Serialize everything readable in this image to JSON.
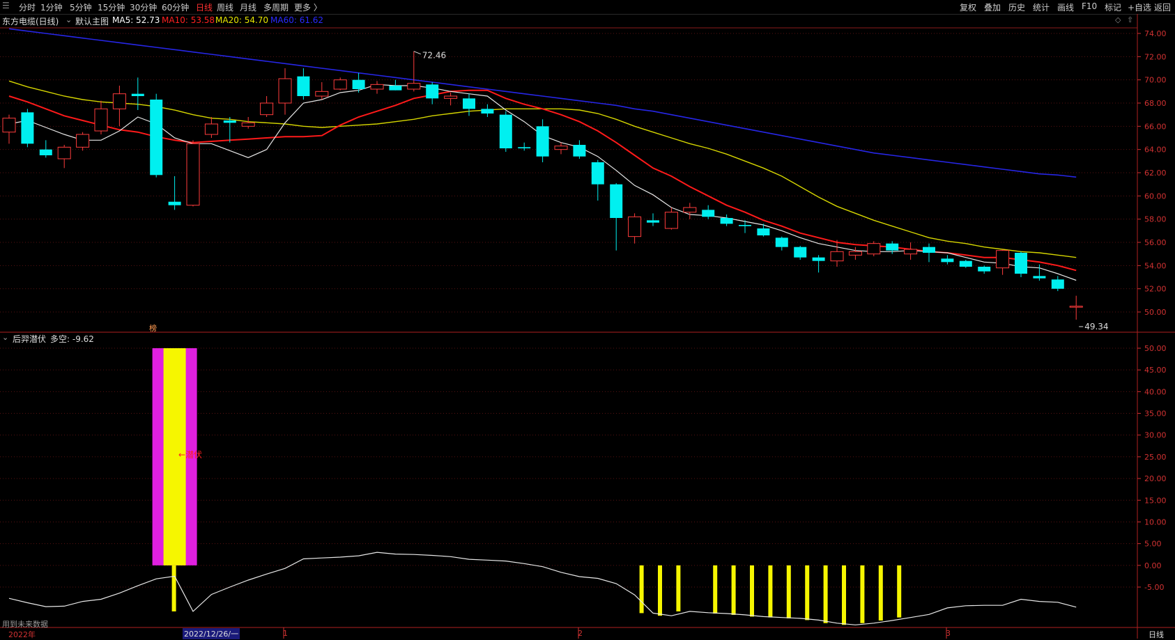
{
  "toolbar": {
    "left_icon": "menu-icon",
    "periods": [
      "分时",
      "1分钟",
      "5分钟",
      "15分钟",
      "30分钟",
      "60分钟",
      "日线",
      "周线",
      "月线",
      "多周期",
      "更多 〉"
    ],
    "active_period": "日线",
    "right_items": [
      "复权",
      "叠加",
      "历史",
      "统计",
      "画线",
      "F10",
      "标记",
      "+自选",
      "返回"
    ]
  },
  "main_info": {
    "stock": "东方电缆(日线)",
    "template": "默认主图",
    "ma5_label": "MA5: 52.73",
    "ma10_label": "MA10: 53.58",
    "ma20_label": "MA20: 54.70",
    "ma60_label": "MA60: 61.62",
    "colors": {
      "ma5": "#ffffff",
      "ma10": "#ff2020",
      "ma20": "#e6e600",
      "ma60": "#2020ff"
    }
  },
  "price_axis": {
    "ticks": [
      "74.00",
      "72.00",
      "70.00",
      "68.00",
      "66.00",
      "64.00",
      "62.00",
      "60.00",
      "58.00",
      "56.00",
      "54.00",
      "52.00",
      "50.00"
    ],
    "high_label": "72.46",
    "low_label": "49.34",
    "marker_label": "榜"
  },
  "indicator_info": {
    "name": "后羿潜伏",
    "value_label": "多空: -9.62",
    "signal_label": "←潜伏"
  },
  "indicator_axis": {
    "ticks": [
      "50.00",
      "45.00",
      "40.00",
      "35.00",
      "30.00",
      "25.00",
      "20.00",
      "15.00",
      "10.00",
      "5.00",
      "0.00",
      "-5.00"
    ]
  },
  "footer": {
    "note": "用到未来数据",
    "year_label": "2022年",
    "cursor_date": "2022/12/26/一",
    "month_labels": [
      "1",
      "2",
      "3"
    ],
    "period_label": "日线"
  },
  "chart_data": {
    "type": "candlestick",
    "candles": [
      {
        "o": 65.5,
        "c": 66.7,
        "h": 67.0,
        "l": 64.5
      },
      {
        "o": 67.2,
        "c": 64.5,
        "h": 67.5,
        "l": 64.2
      },
      {
        "o": 64.0,
        "c": 63.5,
        "h": 64.8,
        "l": 63.3
      },
      {
        "o": 63.2,
        "c": 64.2,
        "h": 64.4,
        "l": 62.4
      },
      {
        "o": 64.2,
        "c": 65.3,
        "h": 65.5,
        "l": 63.9
      },
      {
        "o": 65.6,
        "c": 67.5,
        "h": 68.2,
        "l": 65.3
      },
      {
        "o": 67.5,
        "c": 68.8,
        "h": 69.5,
        "l": 66.0
      },
      {
        "o": 68.8,
        "c": 68.6,
        "h": 70.2,
        "l": 67.4
      },
      {
        "o": 68.3,
        "c": 61.8,
        "h": 68.8,
        "l": 61.6
      },
      {
        "o": 59.5,
        "c": 59.2,
        "h": 61.7,
        "l": 58.8
      },
      {
        "o": 59.2,
        "c": 64.5,
        "h": 64.8,
        "l": 59.1
      },
      {
        "o": 65.3,
        "c": 66.2,
        "h": 66.8,
        "l": 65.0
      },
      {
        "o": 66.5,
        "c": 66.3,
        "h": 66.8,
        "l": 64.6
      },
      {
        "o": 66.0,
        "c": 66.3,
        "h": 66.8,
        "l": 65.8
      },
      {
        "o": 67.0,
        "c": 68.0,
        "h": 68.6,
        "l": 66.8
      },
      {
        "o": 68.0,
        "c": 70.1,
        "h": 71.0,
        "l": 67.0
      },
      {
        "o": 70.3,
        "c": 68.6,
        "h": 71.0,
        "l": 68.3
      },
      {
        "o": 68.6,
        "c": 69.0,
        "h": 69.8,
        "l": 68.3
      },
      {
        "o": 69.2,
        "c": 70.0,
        "h": 70.2,
        "l": 69.1
      },
      {
        "o": 70.0,
        "c": 69.2,
        "h": 70.6,
        "l": 68.9
      },
      {
        "o": 69.2,
        "c": 69.6,
        "h": 69.9,
        "l": 68.8
      },
      {
        "o": 69.5,
        "c": 69.1,
        "h": 70.0,
        "l": 69.1
      },
      {
        "o": 69.2,
        "c": 69.7,
        "h": 72.46,
        "l": 69.0
      },
      {
        "o": 69.6,
        "c": 68.4,
        "h": 69.8,
        "l": 67.9
      },
      {
        "o": 68.4,
        "c": 68.6,
        "h": 68.9,
        "l": 67.8
      },
      {
        "o": 68.4,
        "c": 67.5,
        "h": 68.8,
        "l": 66.9
      },
      {
        "o": 67.5,
        "c": 67.1,
        "h": 67.9,
        "l": 66.8
      },
      {
        "o": 67.0,
        "c": 64.1,
        "h": 67.3,
        "l": 63.8
      },
      {
        "o": 64.2,
        "c": 64.1,
        "h": 64.6,
        "l": 63.9
      },
      {
        "o": 66.0,
        "c": 63.4,
        "h": 66.6,
        "l": 62.9
      },
      {
        "o": 64.0,
        "c": 64.3,
        "h": 64.6,
        "l": 63.6
      },
      {
        "o": 64.4,
        "c": 63.4,
        "h": 64.8,
        "l": 63.2
      },
      {
        "o": 62.9,
        "c": 61.0,
        "h": 63.1,
        "l": 59.6
      },
      {
        "o": 61.0,
        "c": 58.1,
        "h": 61.1,
        "l": 55.3
      },
      {
        "o": 56.5,
        "c": 58.2,
        "h": 58.5,
        "l": 55.9
      },
      {
        "o": 57.9,
        "c": 57.7,
        "h": 58.5,
        "l": 57.4
      },
      {
        "o": 57.2,
        "c": 58.6,
        "h": 59.0,
        "l": 57.1
      },
      {
        "o": 58.6,
        "c": 59.0,
        "h": 59.4,
        "l": 58.0
      },
      {
        "o": 58.8,
        "c": 58.2,
        "h": 59.2,
        "l": 58.0
      },
      {
        "o": 58.1,
        "c": 57.6,
        "h": 58.4,
        "l": 57.4
      },
      {
        "o": 57.5,
        "c": 57.4,
        "h": 57.9,
        "l": 56.8
      },
      {
        "o": 57.2,
        "c": 56.6,
        "h": 57.6,
        "l": 56.5
      },
      {
        "o": 56.4,
        "c": 55.6,
        "h": 56.5,
        "l": 55.3
      },
      {
        "o": 55.6,
        "c": 54.7,
        "h": 55.7,
        "l": 54.5
      },
      {
        "o": 54.7,
        "c": 54.4,
        "h": 54.9,
        "l": 53.4
      },
      {
        "o": 54.4,
        "c": 55.2,
        "h": 56.2,
        "l": 53.9
      },
      {
        "o": 54.9,
        "c": 55.2,
        "h": 55.6,
        "l": 54.5
      },
      {
        "o": 55.0,
        "c": 55.9,
        "h": 56.1,
        "l": 54.8
      },
      {
        "o": 55.9,
        "c": 55.3,
        "h": 56.1,
        "l": 55.0
      },
      {
        "o": 55.0,
        "c": 55.4,
        "h": 56.0,
        "l": 54.5
      },
      {
        "o": 55.6,
        "c": 55.1,
        "h": 55.9,
        "l": 54.3
      },
      {
        "o": 54.6,
        "c": 54.3,
        "h": 54.9,
        "l": 54.1
      },
      {
        "o": 54.4,
        "c": 53.9,
        "h": 54.5,
        "l": 53.8
      },
      {
        "o": 53.9,
        "c": 53.5,
        "h": 54.0,
        "l": 53.3
      },
      {
        "o": 53.8,
        "c": 55.3,
        "h": 55.4,
        "l": 53.2
      },
      {
        "o": 55.1,
        "c": 53.3,
        "h": 55.2,
        "l": 53.0
      },
      {
        "o": 53.1,
        "c": 52.9,
        "h": 54.1,
        "l": 52.7
      },
      {
        "o": 52.8,
        "c": 52.0,
        "h": 53.1,
        "l": 51.8
      },
      {
        "o": 50.5,
        "c": 50.5,
        "h": 51.4,
        "l": 49.34
      }
    ],
    "ma5": [
      66.2,
      66.5,
      65.9,
      65.3,
      64.8,
      64.8,
      65.6,
      66.8,
      66.2,
      65.0,
      64.5,
      64.5,
      63.9,
      63.3,
      64.0,
      66.3,
      68.0,
      68.3,
      68.9,
      69.1,
      69.6,
      69.5,
      69.5,
      69.3,
      69.0,
      68.8,
      68.6,
      67.4,
      66.4,
      65.2,
      64.6,
      64.2,
      63.4,
      62.2,
      60.9,
      60.1,
      59.0,
      58.4,
      58.3,
      58.1,
      57.8,
      57.5,
      57.0,
      56.4,
      55.9,
      55.6,
      55.3,
      55.2,
      55.2,
      55.3,
      55.2,
      55.1,
      54.7,
      54.3,
      54.2,
      53.9,
      53.8,
      53.3,
      52.73
    ],
    "ma10": [
      68.6,
      68.1,
      67.5,
      66.9,
      66.5,
      66.1,
      65.7,
      65.5,
      65.1,
      64.8,
      64.6,
      64.7,
      64.8,
      64.9,
      65.0,
      65.1,
      65.1,
      65.2,
      66.1,
      66.8,
      67.3,
      67.8,
      68.4,
      68.7,
      69.0,
      69.1,
      69.1,
      68.4,
      67.9,
      67.5,
      67.0,
      66.4,
      65.6,
      64.6,
      63.5,
      62.4,
      61.7,
      60.8,
      60.0,
      59.2,
      58.6,
      57.9,
      57.4,
      56.8,
      56.4,
      56.0,
      55.8,
      55.7,
      55.6,
      55.4,
      55.2,
      55.1,
      54.9,
      54.7,
      54.7,
      54.5,
      54.3,
      54.0,
      53.58
    ],
    "ma20": [
      69.9,
      69.4,
      69.0,
      68.6,
      68.3,
      68.1,
      68.0,
      67.9,
      67.7,
      67.4,
      67.0,
      66.7,
      66.6,
      66.4,
      66.3,
      66.2,
      66.0,
      65.9,
      66.0,
      66.1,
      66.2,
      66.4,
      66.6,
      66.9,
      67.1,
      67.3,
      67.4,
      67.5,
      67.5,
      67.5,
      67.5,
      67.4,
      67.1,
      66.6,
      66.0,
      65.5,
      65.0,
      64.5,
      64.1,
      63.6,
      63.0,
      62.4,
      61.7,
      60.8,
      59.9,
      59.1,
      58.5,
      57.9,
      57.4,
      56.9,
      56.4,
      56.1,
      55.9,
      55.6,
      55.4,
      55.2,
      55.1,
      54.9,
      54.7
    ],
    "ma60": [
      74.4,
      74.2,
      74.0,
      73.8,
      73.6,
      73.4,
      73.2,
      73.0,
      72.8,
      72.6,
      72.4,
      72.2,
      72.0,
      71.8,
      71.6,
      71.4,
      71.2,
      71.0,
      70.8,
      70.6,
      70.4,
      70.2,
      70.0,
      69.8,
      69.6,
      69.4,
      69.2,
      69.0,
      68.8,
      68.6,
      68.4,
      68.2,
      68.0,
      67.8,
      67.5,
      67.3,
      67.0,
      66.7,
      66.4,
      66.1,
      65.8,
      65.5,
      65.2,
      64.9,
      64.6,
      64.3,
      64.0,
      63.7,
      63.5,
      63.3,
      63.1,
      62.9,
      62.7,
      62.5,
      62.3,
      62.1,
      61.9,
      61.8,
      61.62
    ],
    "indicator_line": [
      -7.6,
      -8.6,
      -9.5,
      -9.4,
      -8.3,
      -7.8,
      -6.4,
      -4.7,
      -3.1,
      -2.5,
      -10.6,
      -6.7,
      -5.0,
      -3.4,
      -2.0,
      -0.7,
      1.5,
      1.7,
      1.9,
      2.2,
      3.0,
      2.6,
      2.5,
      2.3,
      2.0,
      1.4,
      1.2,
      1.0,
      0.4,
      -0.3,
      -1.6,
      -2.6,
      -3.0,
      -4.2,
      -6.8,
      -11.0,
      -11.6,
      -10.6,
      -10.9,
      -11.1,
      -11.4,
      -11.8,
      -12.0,
      -12.2,
      -12.6,
      -13.3,
      -13.7,
      -13.3,
      -12.7,
      -12.0,
      -11.3,
      -9.8,
      -9.3,
      -9.2,
      -9.2,
      -7.8,
      -8.3,
      -8.5,
      -9.62
    ],
    "indicator_big_bar": {
      "index": 9,
      "top": 50.0,
      "bottom": 0.0
    },
    "indicator_bars": [
      34,
      35,
      36,
      38,
      39,
      40,
      41,
      42,
      43,
      44,
      45,
      46,
      47,
      48
    ]
  }
}
